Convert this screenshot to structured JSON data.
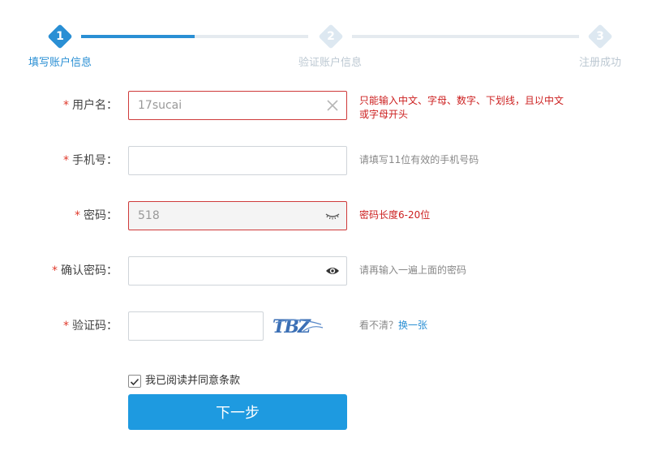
{
  "stepper": {
    "steps": [
      {
        "number": "1",
        "label": "填写账户信息",
        "state": "active"
      },
      {
        "number": "2",
        "label": "验证账户信息",
        "state": "inactive"
      },
      {
        "number": "3",
        "label": "注册成功",
        "state": "inactive"
      }
    ],
    "progress_fraction_segment1": 0.5
  },
  "form": {
    "required_mark": "*",
    "username": {
      "label": "用户名：",
      "value": "17sucai",
      "error": "只能输入中文、字母、数字、下划线，且以中文或字母开头"
    },
    "phone": {
      "label": "手机号：",
      "value": "",
      "hint": "请填写11位有效的手机号码"
    },
    "password": {
      "label": "密码：",
      "value": "518",
      "error": "密码长度6-20位"
    },
    "confirm_password": {
      "label": "确认密码：",
      "value": "",
      "hint": "请再输入一遍上面的密码"
    },
    "captcha": {
      "label": "验证码：",
      "value": "",
      "image_text": "TBZ",
      "hint_prefix": "看不清？",
      "refresh_link": "换一张"
    },
    "agree": {
      "label": "我已阅读并同意条款",
      "checked": true
    },
    "submit_label": "下一步"
  },
  "colors": {
    "accent": "#2a8fd4",
    "error": "#cc1f1f",
    "button": "#1e9ae0"
  },
  "icons": {
    "username_clear": "close-icon",
    "password_toggle": "eye-closed-icon",
    "confirm_toggle": "eye-icon",
    "agree_check": "checkmark-icon"
  }
}
